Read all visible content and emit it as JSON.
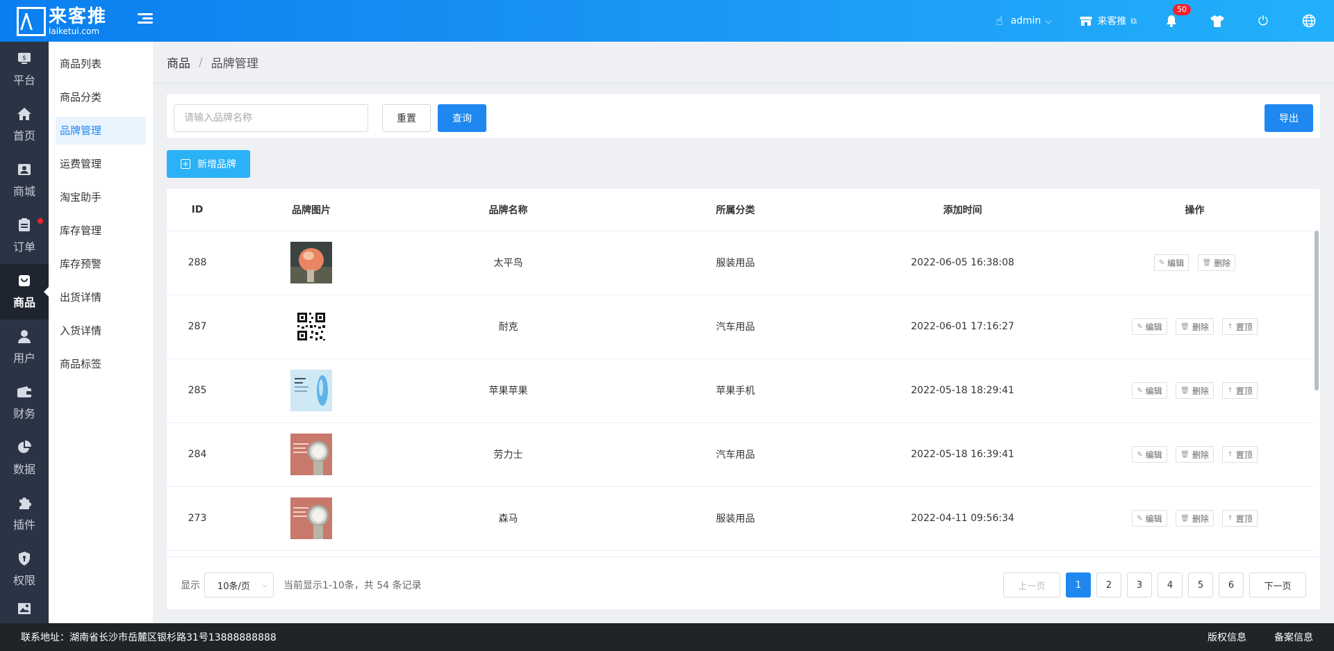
{
  "header": {
    "logo_title": "来客推",
    "logo_sub": "laiketui.com",
    "user": "admin",
    "store": "来客推",
    "notification_count": "50",
    "icons": [
      "hand-icon",
      "store-icon",
      "bell-icon",
      "shirt-icon",
      "power-icon",
      "globe-icon"
    ]
  },
  "sidenav": [
    {
      "label": "平台",
      "icon": "platform-icon"
    },
    {
      "label": "首页",
      "icon": "home-icon"
    },
    {
      "label": "商城",
      "icon": "mall-icon"
    },
    {
      "label": "订单",
      "icon": "order-icon"
    },
    {
      "label": "商品",
      "icon": "goods-icon"
    },
    {
      "label": "用户",
      "icon": "user-icon"
    },
    {
      "label": "财务",
      "icon": "wallet-icon"
    },
    {
      "label": "数据",
      "icon": "pie-icon"
    },
    {
      "label": "插件",
      "icon": "puzzle-icon"
    },
    {
      "label": "权限",
      "icon": "shield-icon"
    }
  ],
  "submenu": [
    "商品列表",
    "商品分类",
    "品牌管理",
    "运费管理",
    "淘宝助手",
    "库存管理",
    "库存预警",
    "出货详情",
    "入货详情",
    "商品标签"
  ],
  "breadcrumb": {
    "parent": "商品",
    "current": "品牌管理"
  },
  "filter": {
    "placeholder": "请输入品牌名称",
    "reset_label": "重置",
    "query_label": "查询",
    "export_label": "导出"
  },
  "add_label": "新增品牌",
  "table": {
    "columns": [
      "ID",
      "品牌图片",
      "品牌名称",
      "所属分类",
      "添加时间",
      "操作"
    ],
    "rows": [
      {
        "id": "288",
        "name": "太平鸟",
        "category": "服装用品",
        "time": "2022-06-05 16:38:08"
      },
      {
        "id": "287",
        "name": "耐克",
        "category": "汽车用品",
        "time": "2022-06-01 17:16:27"
      },
      {
        "id": "285",
        "name": "苹果苹果",
        "category": "苹果手机",
        "time": "2022-05-18 18:29:41"
      },
      {
        "id": "284",
        "name": "劳力士",
        "category": "汽车用品",
        "time": "2022-05-18 16:39:41"
      },
      {
        "id": "273",
        "name": "森马",
        "category": "服装用品",
        "time": "2022-04-11 09:56:34"
      }
    ],
    "ops": {
      "edit": "编辑",
      "delete": "删除",
      "top": "置顶"
    }
  },
  "pager": {
    "show_label": "显示",
    "page_size": "10条/页",
    "summary": "当前显示1-10条，共 54 条记录",
    "prev": "上一页",
    "next": "下一页",
    "pages": [
      "1",
      "2",
      "3",
      "4",
      "5",
      "6"
    ],
    "current": "1"
  },
  "footer": {
    "address": "联系地址：湖南省长沙市岳麓区银杉路31号13888888888",
    "copyright": "版权信息",
    "record": "备案信息"
  },
  "colors": {
    "primary": "#1e88f0",
    "add_button": "#2bb1f5",
    "sidebar": "#2b3444"
  }
}
